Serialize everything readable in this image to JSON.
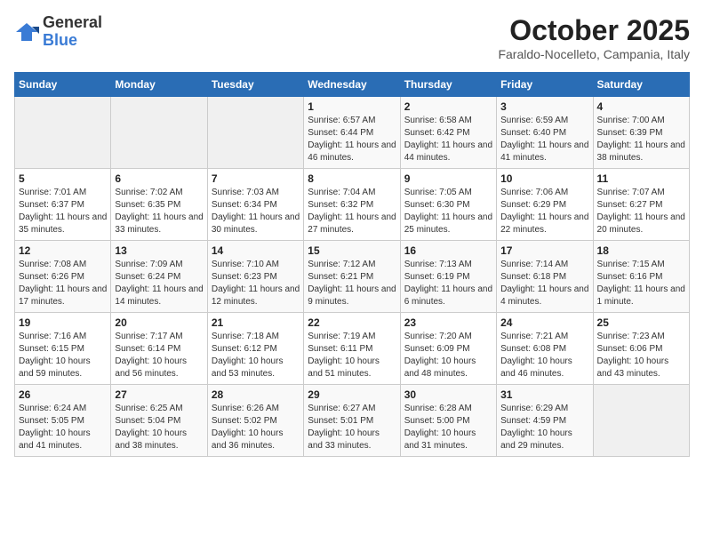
{
  "logo": {
    "general": "General",
    "blue": "Blue"
  },
  "header": {
    "month": "October 2025",
    "location": "Faraldo-Nocelleto, Campania, Italy"
  },
  "weekdays": [
    "Sunday",
    "Monday",
    "Tuesday",
    "Wednesday",
    "Thursday",
    "Friday",
    "Saturday"
  ],
  "weeks": [
    [
      {
        "day": "",
        "empty": true
      },
      {
        "day": "",
        "empty": true
      },
      {
        "day": "",
        "empty": true
      },
      {
        "day": "1",
        "sunrise": "6:57 AM",
        "sunset": "6:44 PM",
        "daylight": "11 hours and 46 minutes."
      },
      {
        "day": "2",
        "sunrise": "6:58 AM",
        "sunset": "6:42 PM",
        "daylight": "11 hours and 44 minutes."
      },
      {
        "day": "3",
        "sunrise": "6:59 AM",
        "sunset": "6:40 PM",
        "daylight": "11 hours and 41 minutes."
      },
      {
        "day": "4",
        "sunrise": "7:00 AM",
        "sunset": "6:39 PM",
        "daylight": "11 hours and 38 minutes."
      }
    ],
    [
      {
        "day": "5",
        "sunrise": "7:01 AM",
        "sunset": "6:37 PM",
        "daylight": "11 hours and 35 minutes."
      },
      {
        "day": "6",
        "sunrise": "7:02 AM",
        "sunset": "6:35 PM",
        "daylight": "11 hours and 33 minutes."
      },
      {
        "day": "7",
        "sunrise": "7:03 AM",
        "sunset": "6:34 PM",
        "daylight": "11 hours and 30 minutes."
      },
      {
        "day": "8",
        "sunrise": "7:04 AM",
        "sunset": "6:32 PM",
        "daylight": "11 hours and 27 minutes."
      },
      {
        "day": "9",
        "sunrise": "7:05 AM",
        "sunset": "6:30 PM",
        "daylight": "11 hours and 25 minutes."
      },
      {
        "day": "10",
        "sunrise": "7:06 AM",
        "sunset": "6:29 PM",
        "daylight": "11 hours and 22 minutes."
      },
      {
        "day": "11",
        "sunrise": "7:07 AM",
        "sunset": "6:27 PM",
        "daylight": "11 hours and 20 minutes."
      }
    ],
    [
      {
        "day": "12",
        "sunrise": "7:08 AM",
        "sunset": "6:26 PM",
        "daylight": "11 hours and 17 minutes."
      },
      {
        "day": "13",
        "sunrise": "7:09 AM",
        "sunset": "6:24 PM",
        "daylight": "11 hours and 14 minutes."
      },
      {
        "day": "14",
        "sunrise": "7:10 AM",
        "sunset": "6:23 PM",
        "daylight": "11 hours and 12 minutes."
      },
      {
        "day": "15",
        "sunrise": "7:12 AM",
        "sunset": "6:21 PM",
        "daylight": "11 hours and 9 minutes."
      },
      {
        "day": "16",
        "sunrise": "7:13 AM",
        "sunset": "6:19 PM",
        "daylight": "11 hours and 6 minutes."
      },
      {
        "day": "17",
        "sunrise": "7:14 AM",
        "sunset": "6:18 PM",
        "daylight": "11 hours and 4 minutes."
      },
      {
        "day": "18",
        "sunrise": "7:15 AM",
        "sunset": "6:16 PM",
        "daylight": "11 hours and 1 minute."
      }
    ],
    [
      {
        "day": "19",
        "sunrise": "7:16 AM",
        "sunset": "6:15 PM",
        "daylight": "10 hours and 59 minutes."
      },
      {
        "day": "20",
        "sunrise": "7:17 AM",
        "sunset": "6:14 PM",
        "daylight": "10 hours and 56 minutes."
      },
      {
        "day": "21",
        "sunrise": "7:18 AM",
        "sunset": "6:12 PM",
        "daylight": "10 hours and 53 minutes."
      },
      {
        "day": "22",
        "sunrise": "7:19 AM",
        "sunset": "6:11 PM",
        "daylight": "10 hours and 51 minutes."
      },
      {
        "day": "23",
        "sunrise": "7:20 AM",
        "sunset": "6:09 PM",
        "daylight": "10 hours and 48 minutes."
      },
      {
        "day": "24",
        "sunrise": "7:21 AM",
        "sunset": "6:08 PM",
        "daylight": "10 hours and 46 minutes."
      },
      {
        "day": "25",
        "sunrise": "7:23 AM",
        "sunset": "6:06 PM",
        "daylight": "10 hours and 43 minutes."
      }
    ],
    [
      {
        "day": "26",
        "sunrise": "6:24 AM",
        "sunset": "5:05 PM",
        "daylight": "10 hours and 41 minutes."
      },
      {
        "day": "27",
        "sunrise": "6:25 AM",
        "sunset": "5:04 PM",
        "daylight": "10 hours and 38 minutes."
      },
      {
        "day": "28",
        "sunrise": "6:26 AM",
        "sunset": "5:02 PM",
        "daylight": "10 hours and 36 minutes."
      },
      {
        "day": "29",
        "sunrise": "6:27 AM",
        "sunset": "5:01 PM",
        "daylight": "10 hours and 33 minutes."
      },
      {
        "day": "30",
        "sunrise": "6:28 AM",
        "sunset": "5:00 PM",
        "daylight": "10 hours and 31 minutes."
      },
      {
        "day": "31",
        "sunrise": "6:29 AM",
        "sunset": "4:59 PM",
        "daylight": "10 hours and 29 minutes."
      },
      {
        "day": "",
        "empty": true
      }
    ]
  ]
}
